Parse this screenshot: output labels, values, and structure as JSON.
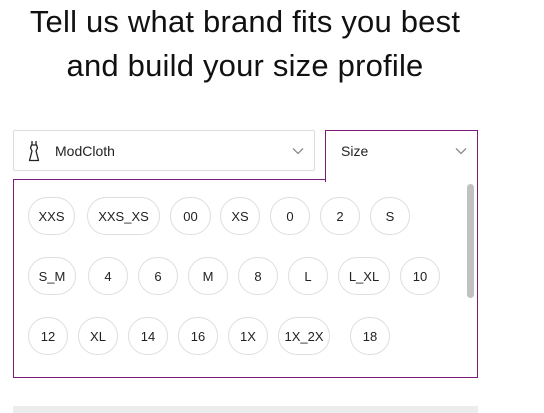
{
  "heading": {
    "line1": "Tell us what brand fits you best",
    "line2": "and build your size profile"
  },
  "brand_select": {
    "value": "ModCloth",
    "icon": "dress-icon",
    "chevron": "chevron-down-icon"
  },
  "size_select": {
    "label": "Size",
    "chevron": "chevron-down-icon"
  },
  "sizes": [
    [
      "XXS",
      "XXS_XS",
      "00",
      "XS",
      "0",
      "2",
      "S"
    ],
    [
      "S_M",
      "4",
      "6",
      "M",
      "8",
      "L",
      "L_XL",
      "10"
    ],
    [
      "12",
      "XL",
      "14",
      "16",
      "1X",
      "1X_2X",
      "18"
    ]
  ],
  "colors": {
    "accent": "#7a1b78",
    "chip_border": "#dedede",
    "scroll_thumb": "#c1c1c1"
  }
}
